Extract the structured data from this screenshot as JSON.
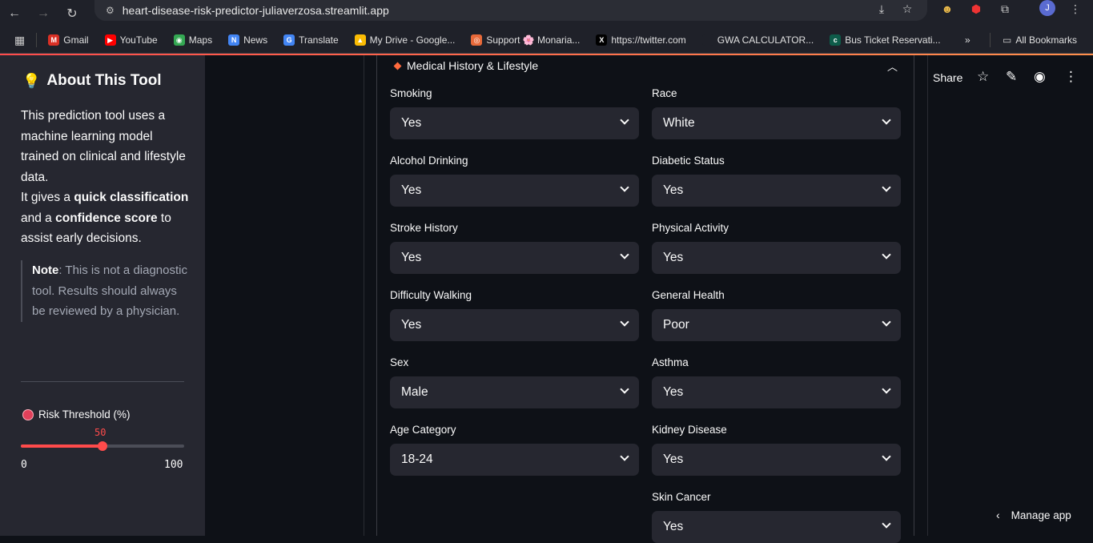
{
  "browser": {
    "url": "heart-disease-risk-predictor-juliaverzosa.streamlit.app",
    "profile_initial": "J",
    "bookmarks": [
      {
        "label": "Gmail",
        "color": "#d93025",
        "glyph": "M"
      },
      {
        "label": "YouTube",
        "color": "#ff0000",
        "glyph": "▶"
      },
      {
        "label": "Maps",
        "color": "#34a853",
        "glyph": "◉"
      },
      {
        "label": "News",
        "color": "#4285f4",
        "glyph": "N"
      },
      {
        "label": "Translate",
        "color": "#4285f4",
        "glyph": "G"
      },
      {
        "label": "My Drive - Google...",
        "color": "#fbbc04",
        "glyph": "▲"
      },
      {
        "label": "Support 🌸 Monaria...",
        "color": "#e86a3a",
        "glyph": "◎"
      },
      {
        "label": "https://twitter.com",
        "color": "#000000",
        "glyph": "X"
      },
      {
        "label": "GWA CALCULATOR...",
        "color": "#1f2129",
        "glyph": ""
      },
      {
        "label": "Bus Ticket Reservati...",
        "color": "#0e5c4a",
        "glyph": "c"
      }
    ],
    "all_bookmarks": "All Bookmarks"
  },
  "sidebar": {
    "about_title": "About This Tool",
    "about_p1": "This prediction tool uses a machine learning model trained on clinical and lifestyle data.",
    "about_p2_a": "It gives a ",
    "about_p2_b": "quick classification",
    "about_p2_c": " and a ",
    "about_p2_d": "confidence score",
    "about_p2_e": " to assist early decisions.",
    "note_bold": "Note",
    "note_text": ": This is not a diagnostic tool. Results should always be reviewed by a physician.",
    "risk_label": "Risk Threshold (%)",
    "slider_value": "50",
    "slider_min": "0",
    "slider_max": "100",
    "slider_fraction": 0.5
  },
  "main": {
    "expander_title": "Medical History & Lifestyle",
    "fields_left": [
      {
        "label": "Smoking",
        "value": "Yes"
      },
      {
        "label": "Alcohol Drinking",
        "value": "Yes"
      },
      {
        "label": "Stroke History",
        "value": "Yes"
      },
      {
        "label": "Difficulty Walking",
        "value": "Yes"
      },
      {
        "label": "Sex",
        "value": "Male"
      },
      {
        "label": "Age Category",
        "value": "18-24"
      }
    ],
    "fields_right": [
      {
        "label": "Race",
        "value": "White"
      },
      {
        "label": "Diabetic Status",
        "value": "Yes"
      },
      {
        "label": "Physical Activity",
        "value": "Yes"
      },
      {
        "label": "General Health",
        "value": "Poor"
      },
      {
        "label": "Asthma",
        "value": "Yes"
      },
      {
        "label": "Kidney Disease",
        "value": "Yes"
      },
      {
        "label": "Skin Cancer",
        "value": "Yes"
      }
    ]
  },
  "toolbar": {
    "share_label": "Share",
    "manage_app": "Manage app"
  },
  "colors": {
    "accent": "#ff4b4b",
    "sidebar_bg": "#262730",
    "app_bg": "#0e1117"
  }
}
